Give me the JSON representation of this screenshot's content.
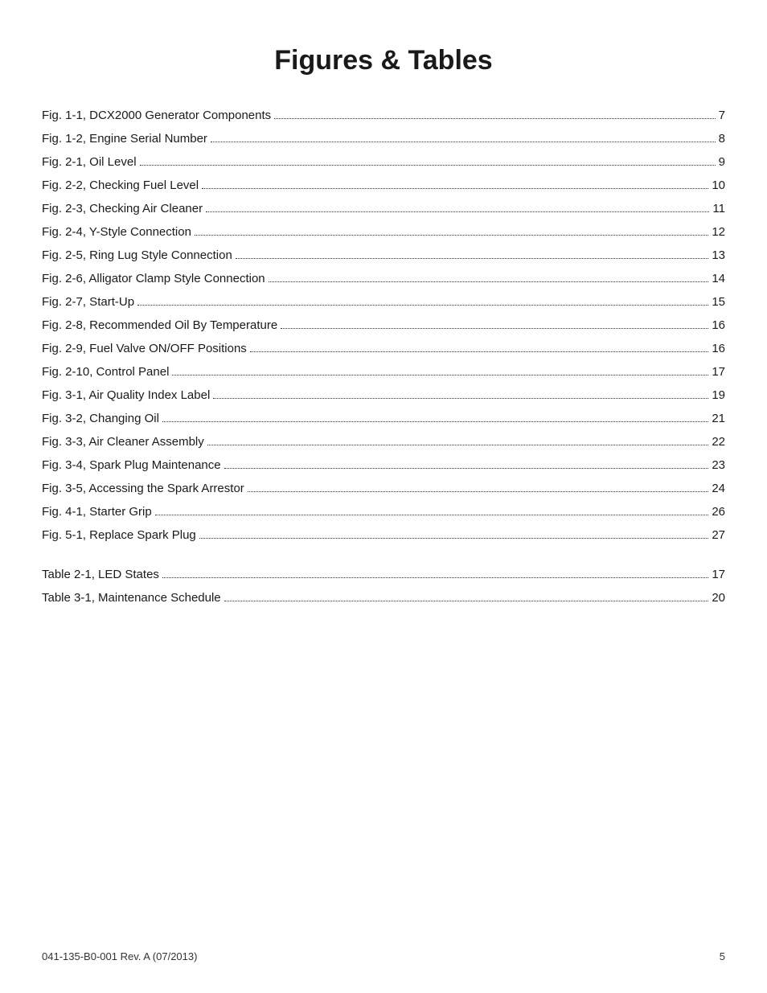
{
  "title": "Figures & Tables",
  "figures": [
    {
      "label": "Fig. 1-1, DCX2000 Generator Components",
      "page": "7"
    },
    {
      "label": "Fig. 1-2, Engine Serial Number",
      "page": "8"
    },
    {
      "label": "Fig. 2-1, Oil Level",
      "page": "9"
    },
    {
      "label": "Fig. 2-2, Checking Fuel Level",
      "page": "10"
    },
    {
      "label": "Fig. 2-3, Checking Air Cleaner",
      "page": "11"
    },
    {
      "label": "Fig. 2-4, Y-Style Connection",
      "page": "12"
    },
    {
      "label": "Fig. 2-5, Ring Lug Style Connection",
      "page": "13"
    },
    {
      "label": "Fig. 2-6, Alligator Clamp Style Connection",
      "page": "14"
    },
    {
      "label": "Fig. 2-7, Start-Up",
      "page": "15"
    },
    {
      "label": "Fig. 2-8, Recommended Oil By Temperature",
      "page": "16"
    },
    {
      "label": "Fig. 2-9, Fuel Valve ON/OFF Positions",
      "page": "16"
    },
    {
      "label": "Fig. 2-10, Control Panel",
      "page": "17"
    },
    {
      "label": "Fig. 3-1, Air Quality Index Label",
      "page": "19"
    },
    {
      "label": "Fig. 3-2, Changing Oil",
      "page": "21"
    },
    {
      "label": "Fig. 3-3, Air Cleaner Assembly",
      "page": "22"
    },
    {
      "label": "Fig. 3-4, Spark Plug Maintenance",
      "page": "23"
    },
    {
      "label": "Fig. 3-5, Accessing the Spark Arrestor",
      "page": "24"
    },
    {
      "label": "Fig. 4-1, Starter Grip",
      "page": "26"
    },
    {
      "label": "Fig. 5-1, Replace Spark Plug",
      "page": "27"
    }
  ],
  "tables": [
    {
      "label": "Table 2-1, LED States",
      "page": "17"
    },
    {
      "label": "Table 3-1, Maintenance Schedule",
      "page": "20"
    }
  ],
  "footer": {
    "doc_id": "041-135-B0-001 Rev. A (07/2013)",
    "page_number": "5"
  }
}
